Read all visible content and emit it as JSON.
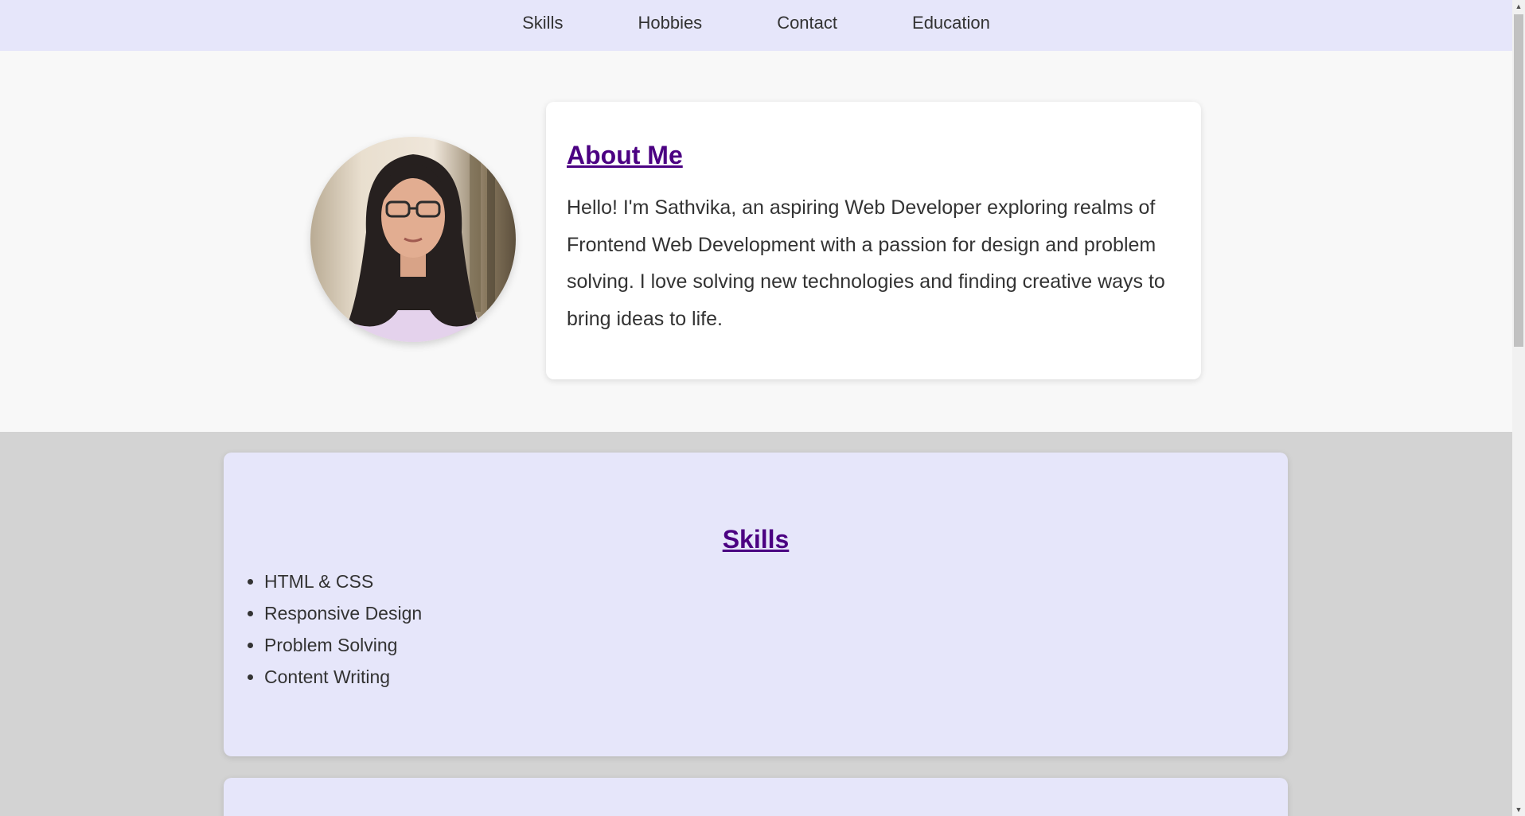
{
  "nav": {
    "items": [
      {
        "label": "Skills"
      },
      {
        "label": "Hobbies"
      },
      {
        "label": "Contact"
      },
      {
        "label": "Education"
      }
    ]
  },
  "about": {
    "heading": "About Me",
    "text": "Hello! I'm Sathvika, an aspiring Web Developer exploring realms of Frontend Web Development with a passion for design and problem solving. I love solving new technologies and finding creative ways to bring ideas to life."
  },
  "skills": {
    "heading": "Skills",
    "items": [
      "HTML & CSS",
      "Responsive Design",
      "Problem Solving",
      "Content Writing"
    ]
  },
  "colors": {
    "nav_bg": "#e6e6fa",
    "heading": "#4b0082",
    "card_bg": "#e6e6fa",
    "page_bg": "#d3d3d3"
  },
  "icons": {
    "scroll_up": "scroll-up-arrow-icon",
    "scroll_down": "scroll-down-arrow-icon"
  }
}
